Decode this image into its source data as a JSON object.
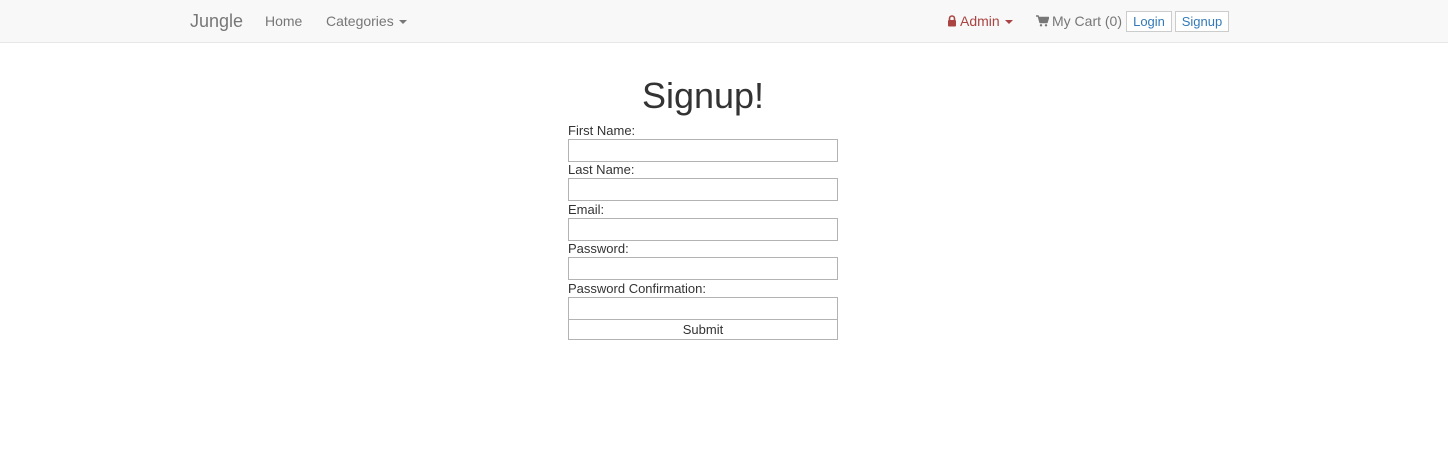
{
  "navbar": {
    "brand": "Jungle",
    "home": "Home",
    "categories": "Categories",
    "admin": "Admin",
    "cart": "My Cart (0)",
    "login": "Login",
    "signup": "Signup"
  },
  "icons": {
    "admin": "lock-icon",
    "cart": "shopping-cart-icon",
    "dropdown": "caret-down-icon"
  },
  "colors": {
    "link": "#337ab7",
    "admin": "#a94442",
    "nav_text": "#777777",
    "navbar_bg": "#f8f8f8"
  },
  "form": {
    "title": "Signup!",
    "first_name_label": "First Name:",
    "last_name_label": "Last Name:",
    "email_label": "Email:",
    "password_label": "Password:",
    "password_confirmation_label": "Password Confirmation:",
    "first_name_value": "",
    "last_name_value": "",
    "email_value": "",
    "password_value": "",
    "password_confirmation_value": "",
    "submit_label": "Submit"
  }
}
